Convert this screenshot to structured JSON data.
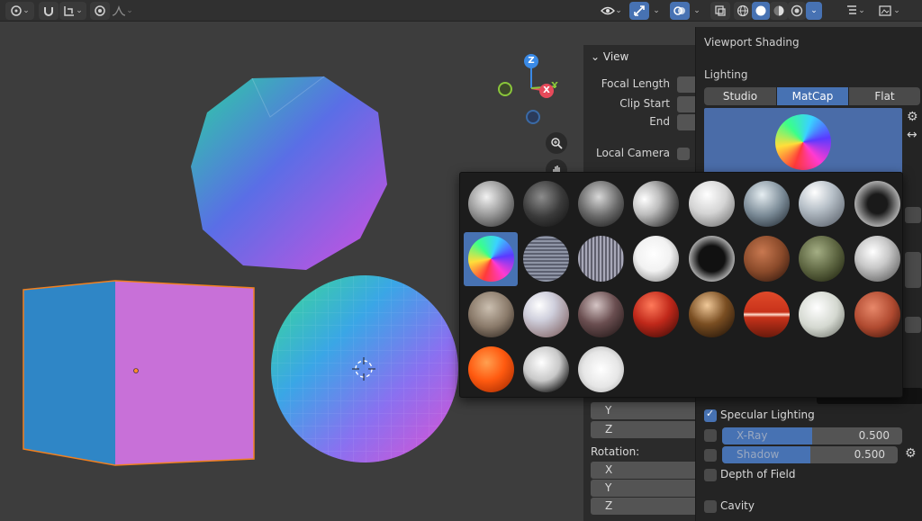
{
  "shading_popover": {
    "title": "Viewport Shading",
    "lighting_label": "Lighting",
    "lighting_options": [
      "Studio",
      "MatCap",
      "Flat"
    ],
    "lighting_selected": "MatCap",
    "options": {
      "specular": "Specular Lighting",
      "xray": "X-Ray",
      "xray_value": "0.500",
      "shadow": "Shadow",
      "shadow_value": "0.500",
      "dof": "Depth of Field",
      "cavity": "Cavity"
    }
  },
  "n_panel": {
    "view_header": "View",
    "focal_length": "Focal Length",
    "clip_start": "Clip Start",
    "clip_end": "End",
    "local_camera": "Local Camera",
    "y_label": "Y",
    "z_label": "Z",
    "rotation_label": "Rotation:",
    "rot_x": "X",
    "rot_y": "Y",
    "rot_z": "Z"
  },
  "gizmo": {
    "z": "Z",
    "x": "X",
    "y": "Y"
  },
  "matcaps": [
    {
      "bg": "radial-gradient(circle at 40% 35%, #f2f2f2, #9a9a9a 45%, #3a3a3a 90%)"
    },
    {
      "bg": "radial-gradient(circle at 40% 35%, #8c8c8c, #3a3a3a 50%, #111 95%)"
    },
    {
      "bg": "radial-gradient(circle at 45% 35%, #d8d8d8, #6a6a6a 50%, #1a1a1a 95%)"
    },
    {
      "bg": "radial-gradient(circle at 25% 40%, #ffffff, #bdbdbd 35%, #3a3a3a 80%)"
    },
    {
      "bg": "radial-gradient(circle at 40% 30%, #ffffff, #d4d4d4 45%, #6a6a6a 95%)"
    },
    {
      "bg": "radial-gradient(circle at 40% 30%, #e6eef2, #7a8a96 50%, #202830 95%)"
    },
    {
      "bg": "radial-gradient(circle at 35% 25%, #ffffff, #b7c0c8 40%, #555c66 95%)"
    },
    {
      "bg": "radial-gradient(circle at 50% 50%, #1a1a1a 30%, #aaaaaa 70%, #222 95%)"
    },
    {
      "bg": "conic-gradient(from 200deg, #ff3a3a, #ffde3a, #3aff8a, #3ad2ff, #5a3aff, #ff3ad2, #ff3a3a)"
    },
    {
      "bg": "repeating-linear-gradient(0deg, #8f95a6 0px, #8f95a6 2px, #5c6070 2px, #5c6070 4px)"
    },
    {
      "bg": "repeating-linear-gradient(90deg, #a8a8b8 0px, #a8a8b8 2px, #60606e 2px, #60606e 4px)"
    },
    {
      "bg": "radial-gradient(circle at 45% 40%, #ffffff, #f2f2f2 45%, #7a7a7a 95%)"
    },
    {
      "bg": "radial-gradient(circle at 50% 50%, #111 40%, #cfcfcf 78%, #333 95%)"
    },
    {
      "bg": "radial-gradient(circle at 40% 35%, #c87850, #8a4a2a 50%, #2a140c 95%)"
    },
    {
      "bg": "radial-gradient(circle at 40% 35%, #a4ae84, #5c6440 50%, #1c200c 95%)"
    },
    {
      "bg": "radial-gradient(circle at 40% 35%, #ffffff, #c8c8c8 40%, #505050 95%)"
    },
    {
      "bg": "radial-gradient(circle at 45% 35%, #cbbfb0, #8a7a6a 50%, #2a221c 95%)"
    },
    {
      "bg": "radial-gradient(circle at 35% 30%, #ffffff, #cfcfdc 35%, #7a5a5a 95%)"
    },
    {
      "bg": "radial-gradient(circle at 40% 30%, #d4c4c4, #6a4e50 45%, #1e1414 95%)"
    },
    {
      "bg": "radial-gradient(circle at 40% 30%, #ff7a5a, #c0281a 45%, #3a0a06 95%)"
    },
    {
      "bg": "radial-gradient(circle at 40% 30%, #f0c898, #7a4e22 45%, #1c1006 95%)"
    },
    {
      "bg": "linear-gradient(180deg, #e04a2a 0%, #c8321a 45%, #ffe0d0 50%, #c8321a 56%, #6a1a0c 100%)"
    },
    {
      "bg": "radial-gradient(circle at 40% 35%, #ffffff, #d4d8d0 50%, #6a6e66 95%)"
    },
    {
      "bg": "radial-gradient(circle at 40% 35%, #e8886a, #b04a30 50%, #3a1208 95%)"
    },
    {
      "bg": "radial-gradient(circle at 40% 35%, #ffa050, #ff5a10 45%, #a02800 95%)"
    },
    {
      "bg": "radial-gradient(circle at 40% 35%, #ffffff, #c8c8c8 45%, #3a3a3a 75%, #1a1a1a 95%)"
    },
    {
      "bg": "radial-gradient(circle at 50% 50%, #ffffff, #e6e6e6 55%, #a8a8a8 95%)"
    }
  ],
  "colors": {
    "accent": "#4772b3",
    "object_outline": "#f08020"
  }
}
